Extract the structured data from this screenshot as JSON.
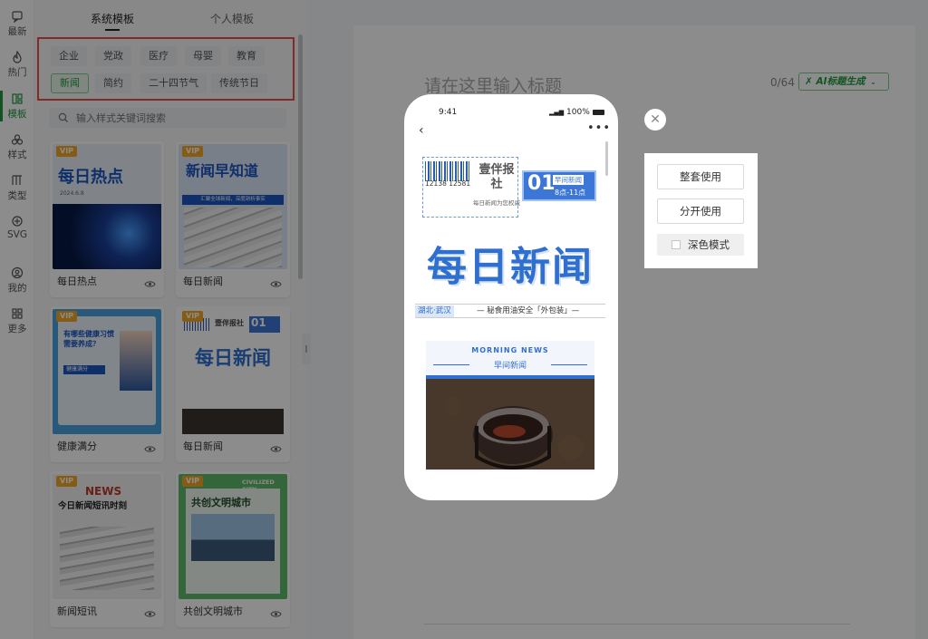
{
  "rail": {
    "items": [
      {
        "label": "最新"
      },
      {
        "label": "热门"
      },
      {
        "label": "模板"
      },
      {
        "label": "样式"
      },
      {
        "label": "类型"
      },
      {
        "label": "SVG"
      },
      {
        "label": "我的"
      },
      {
        "label": "更多"
      }
    ],
    "active_color": "#1f9a3c"
  },
  "panel": {
    "tabs": [
      {
        "label": "系统模板"
      },
      {
        "label": "个人模板"
      }
    ],
    "categories": [
      {
        "label": "企业"
      },
      {
        "label": "党政"
      },
      {
        "label": "医疗"
      },
      {
        "label": "母婴"
      },
      {
        "label": "教育"
      },
      {
        "label": "新闻"
      },
      {
        "label": "简约"
      },
      {
        "label": "二十四节气"
      },
      {
        "label": "传统节日"
      }
    ],
    "search_placeholder": "输入样式关键词搜索",
    "cards": [
      {
        "caption": "每日热点",
        "thumb_title": "每日热点",
        "date": "2024.6.8"
      },
      {
        "caption": "每日新闻",
        "thumb_title": "新闻早知道",
        "sub": "汇聚全球新闻，深度剖析事实"
      },
      {
        "caption": "健康满分",
        "thumb_title": "有哪些健康习惯需要养成？",
        "sub": "健康满分"
      },
      {
        "caption": "每日新闻",
        "thumb_title": "每日新闻",
        "paper": "壹伴报社",
        "num": "01"
      },
      {
        "caption": "新闻短讯",
        "thumb_title": "今日新闻短讯时刻",
        "en": "NEWS"
      },
      {
        "caption": "共创文明城市",
        "thumb_title": "共创文明城市",
        "en": "CIVILIZED CITY"
      }
    ],
    "vip_label": "VIP"
  },
  "editor": {
    "title_placeholder": "请在这里输入标题",
    "counter": "0/64",
    "ai_button": "AI标题生成"
  },
  "preview": {
    "time": "9:41",
    "battery": "100%",
    "barcode_number": "12138 12581",
    "paper_name": "壹伴报社",
    "paper_sub": "每日新闻为您权威",
    "edition_number": "01",
    "edition_tag": "早间新闻",
    "edition_time": "8点-11点",
    "big_title": "每日新闻",
    "place": "湖北·武汉",
    "headline": "— 秘食用油安全「外包装」—",
    "mn_en": "MORNING NEWS",
    "mn_cn": "早间新闻"
  },
  "menu": {
    "whole_use": "整套使用",
    "split_use": "分开使用",
    "dark_mode": "深色模式",
    "dark_mode_checked": false
  }
}
